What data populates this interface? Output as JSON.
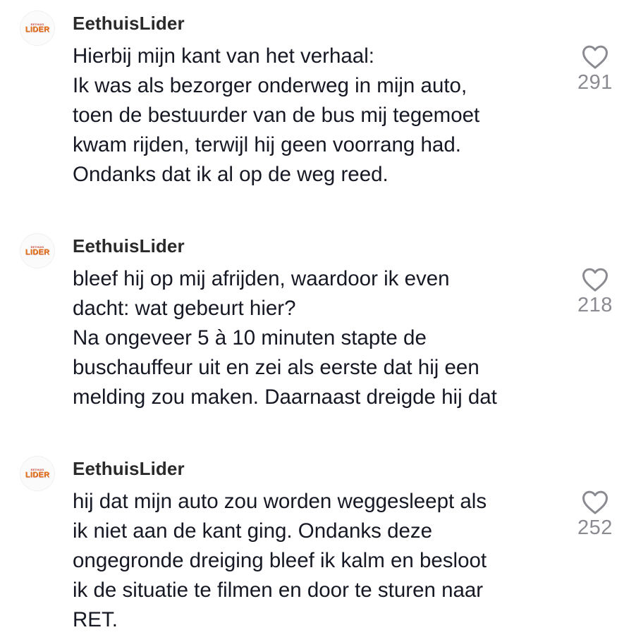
{
  "comments": [
    {
      "avatar": {
        "small_text": "EETHUIS",
        "big_text": "LIDER"
      },
      "username": "EethuisLider",
      "lines": [
        "Hierbij mijn kant van het verhaal:",
        "Ik was als bezorger onderweg in mijn auto,",
        "toen de bestuurder van de bus mij tegemoet",
        "kwam rijden, terwijl hij geen voorrang had.",
        "Ondanks dat ik al op de weg reed."
      ],
      "likes": "291",
      "like_icon": "heart-outline-icon"
    },
    {
      "avatar": {
        "small_text": "EETHUIS",
        "big_text": "LIDER"
      },
      "username": "EethuisLider",
      "lines": [
        "bleef hij op mij afrijden, waardoor ik even",
        "dacht: wat gebeurt hier?",
        "Na ongeveer 5 à 10 minuten stapte de",
        "buschauffeur uit en zei als eerste dat hij een",
        "melding zou maken. Daarnaast dreigde hij dat"
      ],
      "likes": "218",
      "like_icon": "heart-outline-icon"
    },
    {
      "avatar": {
        "small_text": "EETHUIS",
        "big_text": "LIDER"
      },
      "username": "EethuisLider",
      "lines": [
        "hij dat mijn auto zou worden weggesleept als",
        "ik niet aan de kant ging. Ondanks deze",
        "ongegronde dreiging bleef ik kalm en besloot",
        "ik de situatie te filmen en door te sturen naar",
        "RET."
      ],
      "likes": "252",
      "like_icon": "heart-outline-icon"
    }
  ],
  "colors": {
    "text": "#161823",
    "username": "#2a2a2a",
    "like_count": "#8a8b91",
    "heart_stroke": "#8a8b91",
    "avatar_small": "#c0392b",
    "avatar_big": "#e67e22"
  }
}
